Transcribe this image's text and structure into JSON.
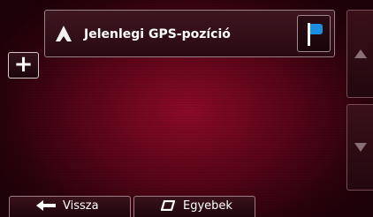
{
  "route": {
    "current_position_label": "Jelenlegi GPS-pozíció",
    "icon": "navigation-arrow-icon",
    "destination_icon": "blue-flag-icon"
  },
  "actions": {
    "add_symbol": "+"
  },
  "scroll": {
    "up_icon": "scroll-up-icon",
    "down_icon": "scroll-down-icon"
  },
  "bottom_bar": {
    "back_label": "Vissza",
    "more_label": "Egyebek"
  },
  "colors": {
    "background": "#5a0518",
    "flag": "#1a8ee0",
    "text": "#ffffff"
  }
}
